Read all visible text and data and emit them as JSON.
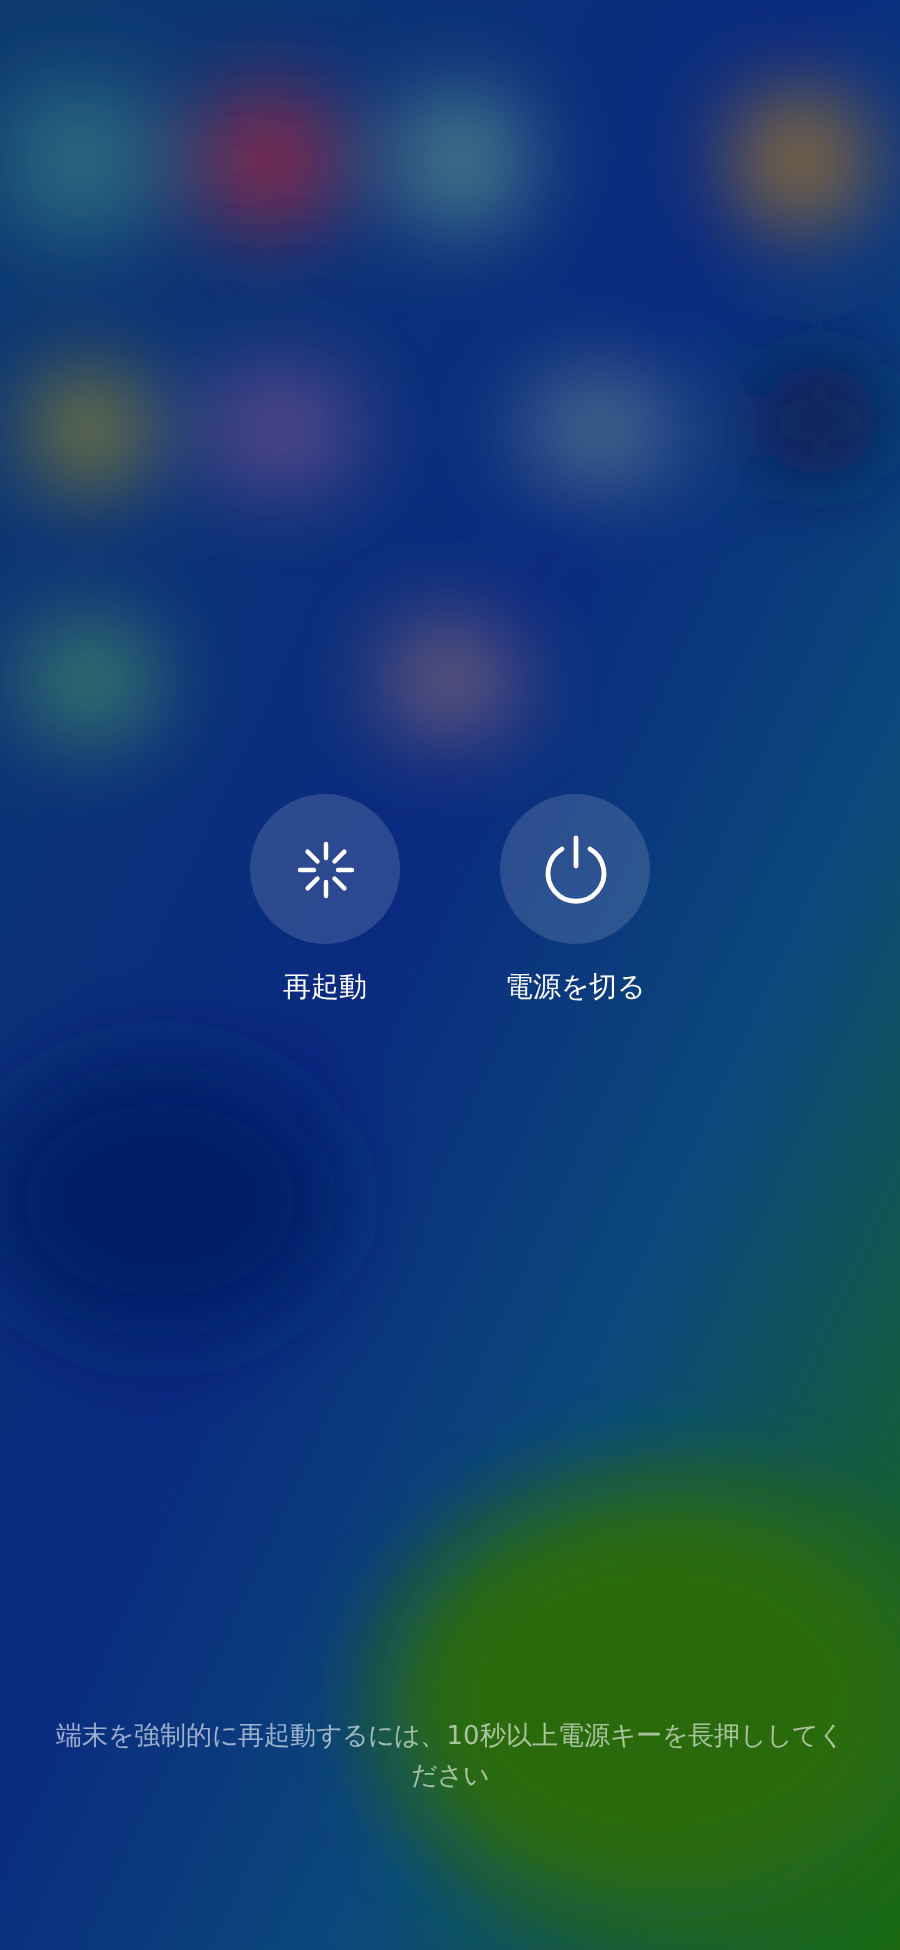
{
  "actions": [
    {
      "kind": "restart",
      "label": "再起動"
    },
    {
      "kind": "power",
      "label": "電源を切る"
    }
  ],
  "hint": "端末を強制的に再起動するには、10秒以上電源キーを長押ししてください"
}
